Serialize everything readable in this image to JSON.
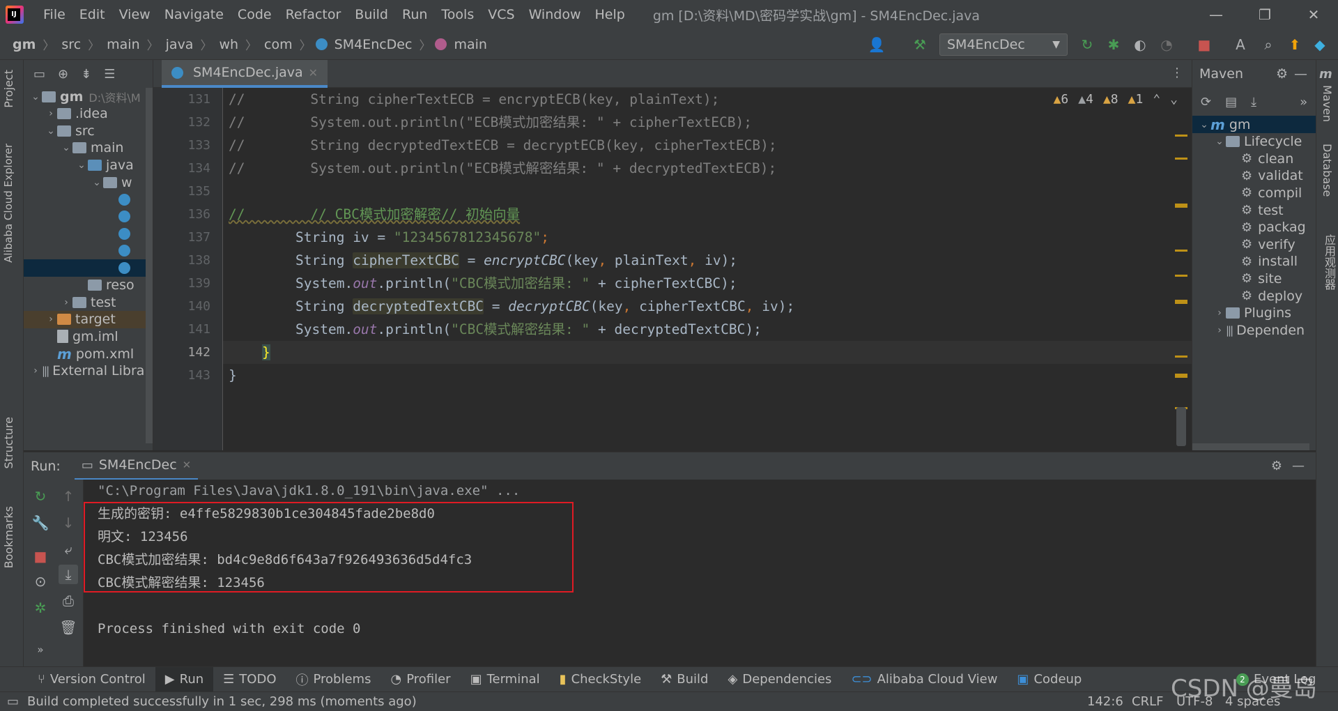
{
  "window": {
    "title": "gm [D:\\资料\\MD\\密码学实战\\gm] - SM4EncDec.java",
    "minimize": "—",
    "restore": "❐",
    "close": "✕"
  },
  "menu": [
    "File",
    "Edit",
    "View",
    "Navigate",
    "Code",
    "Refactor",
    "Build",
    "Run",
    "Tools",
    "VCS",
    "Window",
    "Help"
  ],
  "breadcrumbs": [
    "gm",
    "src",
    "main",
    "java",
    "wh",
    "com",
    "SM4EncDec",
    "main"
  ],
  "run_config": "SM4EncDec",
  "left_stripe": {
    "project": "Project",
    "cloud": "Alibaba Cloud Explorer",
    "structure": "Structure",
    "bookmarks": "Bookmarks"
  },
  "right_stripe": {
    "maven": "Maven",
    "database": "Database",
    "app_observe": "应用观测器"
  },
  "project_tree": [
    {
      "label": "gm",
      "extra": "D:\\资料\\M",
      "indent": 0,
      "arrow": "⌄",
      "icon": "folder",
      "bold": true
    },
    {
      "label": ".idea",
      "indent": 1,
      "arrow": "›",
      "icon": "folder"
    },
    {
      "label": "src",
      "indent": 1,
      "arrow": "⌄",
      "icon": "folder"
    },
    {
      "label": "main",
      "indent": 2,
      "arrow": "⌄",
      "icon": "folder"
    },
    {
      "label": "java",
      "indent": 3,
      "arrow": "⌄",
      "icon": "folder-blue"
    },
    {
      "label": "w",
      "indent": 4,
      "arrow": "⌄",
      "icon": "folder"
    },
    {
      "label": "",
      "indent": 5,
      "arrow": "",
      "icon": "class"
    },
    {
      "label": "",
      "indent": 5,
      "arrow": "",
      "icon": "class"
    },
    {
      "label": "",
      "indent": 5,
      "arrow": "",
      "icon": "class"
    },
    {
      "label": "",
      "indent": 5,
      "arrow": "",
      "icon": "class"
    },
    {
      "label": "",
      "indent": 5,
      "arrow": "",
      "icon": "class",
      "selected": true
    },
    {
      "label": "reso",
      "indent": 3,
      "arrow": "",
      "icon": "folder-res"
    },
    {
      "label": "test",
      "indent": 2,
      "arrow": "›",
      "icon": "folder"
    },
    {
      "label": "target",
      "indent": 1,
      "arrow": "›",
      "icon": "folder-orange",
      "orange": true
    },
    {
      "label": "gm.iml",
      "indent": 1,
      "arrow": "",
      "icon": "file"
    },
    {
      "label": "pom.xml",
      "indent": 1,
      "arrow": "",
      "icon": "maven"
    },
    {
      "label": "External Librar",
      "indent": 0,
      "arrow": "›",
      "icon": "lib"
    }
  ],
  "editor_tab": "SM4EncDec.java",
  "inspections": {
    "warn1": "6",
    "warn2": "4",
    "warn3": "8",
    "weak": "1"
  },
  "line_numbers": [
    "131",
    "132",
    "133",
    "134",
    "135",
    "136",
    "137",
    "138",
    "139",
    "140",
    "141",
    "142",
    "143"
  ],
  "code": {
    "l131a": "//        ",
    "l131b": "String cipherTextECB = encryptECB(key, plainText);",
    "l132a": "//        ",
    "l132b": "System.out.println(\"ECB模式加密结果: \" + cipherTextECB);",
    "l133a": "//        ",
    "l133b": "String decryptedTextECB = decryptECB(key, cipherTextECB);",
    "l134a": "//        ",
    "l134b": "System.out.println(\"ECB模式解密结果: \" + decryptedTextECB);",
    "l136a": "//        ",
    "l136b": "// CBC模式加密解密// 初始向量",
    "l137_kw": "String",
    "l137_var": " iv = ",
    "l137_str": "\"1234567812345678\"",
    "l137_end": ";",
    "l138_kw": "String",
    "l138_var": "cipherTextCBC",
    "l138_eq": " = ",
    "l138_fn": "encryptCBC",
    "l138_args": "(key",
    "l138_c1": ",",
    "l138_a2": " plainText",
    "l138_c2": ",",
    "l138_a3": " iv);",
    "l139_a": "System.",
    "l139_out": "out",
    "l139_b": ".println(",
    "l139_str": "\"CBC模式加密结果: \"",
    "l139_c": " + cipherTextCBC);",
    "l140_kw": "String",
    "l140_var": "decryptedTextCBC",
    "l140_eq": " = ",
    "l140_fn": "decryptCBC",
    "l140_args": "(key",
    "l140_c1": ",",
    "l140_a2": " cipherTextCBC",
    "l140_c2": ",",
    "l140_a3": " iv);",
    "l141_a": "System.",
    "l141_out": "out",
    "l141_b": ".println(",
    "l141_str": "\"CBC模式解密结果: \"",
    "l141_c": " + decryptedTextCBC);",
    "l142": "}",
    "l143": "}"
  },
  "maven": {
    "title": "Maven",
    "items": [
      {
        "label": "gm",
        "indent": 0,
        "arrow": "⌄",
        "selected": true,
        "icon": "m"
      },
      {
        "label": "Lifecycle",
        "indent": 1,
        "arrow": "⌄",
        "icon": "folder"
      },
      {
        "label": "clean",
        "indent": 2,
        "icon": "gear"
      },
      {
        "label": "validat",
        "indent": 2,
        "icon": "gear"
      },
      {
        "label": "compil",
        "indent": 2,
        "icon": "gear"
      },
      {
        "label": "test",
        "indent": 2,
        "icon": "gear"
      },
      {
        "label": "packag",
        "indent": 2,
        "icon": "gear"
      },
      {
        "label": "verify",
        "indent": 2,
        "icon": "gear"
      },
      {
        "label": "install",
        "indent": 2,
        "icon": "gear"
      },
      {
        "label": "site",
        "indent": 2,
        "icon": "gear"
      },
      {
        "label": "deploy",
        "indent": 2,
        "icon": "gear"
      },
      {
        "label": "Plugins",
        "indent": 1,
        "arrow": "›",
        "icon": "folder"
      },
      {
        "label": "Dependen",
        "indent": 1,
        "arrow": "›",
        "icon": "lib"
      }
    ]
  },
  "run": {
    "label": "Run:",
    "tab": "SM4EncDec",
    "console": [
      "\"C:\\Program Files\\Java\\jdk1.8.0_191\\bin\\java.exe\" ...",
      "生成的密钥: e4ffe5829830b1ce304845fade2be8d0",
      "明文: 123456",
      "CBC模式加密结果: bd4c9e8d6f643a7f926493636d5d4fc3",
      "CBC模式解密结果: 123456",
      "",
      "Process finished with exit code 0"
    ]
  },
  "tool_tabs": [
    "Version Control",
    "Run",
    "TODO",
    "Problems",
    "Profiler",
    "Terminal",
    "CheckStyle",
    "Build",
    "Dependencies",
    "Alibaba Cloud View",
    "Codeup"
  ],
  "event_log": "Event Log",
  "event_log_count": "2",
  "status": {
    "message": "Build completed successfully in 1 sec, 298 ms (moments ago)",
    "position": "142:6",
    "line_sep": "CRLF",
    "encoding": "UTF-8",
    "indent": "4 spaces"
  },
  "watermark": "CSDN @曼岛",
  "colors": {
    "accent": "#4a88c7",
    "warning": "#d9a343",
    "highlight_box": "#e01b24",
    "green_run": "#499c54"
  }
}
